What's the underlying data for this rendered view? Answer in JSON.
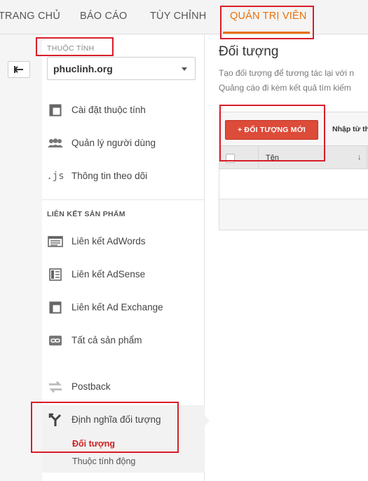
{
  "topnav": {
    "tabs": [
      {
        "label": "TRANG CHỦ"
      },
      {
        "label": "BÁO CÁO"
      },
      {
        "label": "TÙY CHỈNH"
      },
      {
        "label": "QUẢN TRỊ VIÊN"
      }
    ],
    "active_tab": "QUẢN TRỊ VIÊN"
  },
  "sidebar": {
    "property_label": "THUỘC TÍNH",
    "property_value": "phuclinh.org",
    "items": [
      {
        "label": "Cài đặt thuộc tính",
        "icon": "property-settings-icon"
      },
      {
        "label": "Quản lý người dùng",
        "icon": "users-icon"
      },
      {
        "label": "Thông tin theo dõi",
        "icon": "js-icon"
      }
    ],
    "section_title": "LIÊN KẾT SẢN PHẨM",
    "link_items": [
      {
        "label": "Liên kết AdWords",
        "icon": "adwords-icon"
      },
      {
        "label": "Liên kết AdSense",
        "icon": "adsense-icon"
      },
      {
        "label": "Liên kết Ad Exchange",
        "icon": "ad-exchange-icon"
      },
      {
        "label": "Tất cả sản phẩm",
        "icon": "link-icon"
      }
    ],
    "postback": {
      "label": "Postback",
      "icon": "postback-icon"
    },
    "audience_def": {
      "label": "Định nghĩa đối tượng",
      "icon": "fork-icon"
    },
    "sub_items": [
      {
        "label": "Đối tượng",
        "active": true
      },
      {
        "label": "Thuộc tính động",
        "active": false
      }
    ]
  },
  "main": {
    "title": "Đối tượng",
    "desc_line1": "Tạo đối tượng để tương tác lại với n",
    "desc_line2": "Quảng cáo đi kèm kết quả tìm kiếm ",
    "new_button": "+ ĐỐI TƯỢNG MỚI",
    "import_label": "Nhập từ th",
    "table": {
      "col_name": "Tên",
      "sort_icon": "↓"
    }
  },
  "colors": {
    "accent_orange": "#e8710a",
    "button_red": "#dd4b39",
    "highlight_red": "#d81e2a",
    "active_sub_red": "#cc2222"
  }
}
